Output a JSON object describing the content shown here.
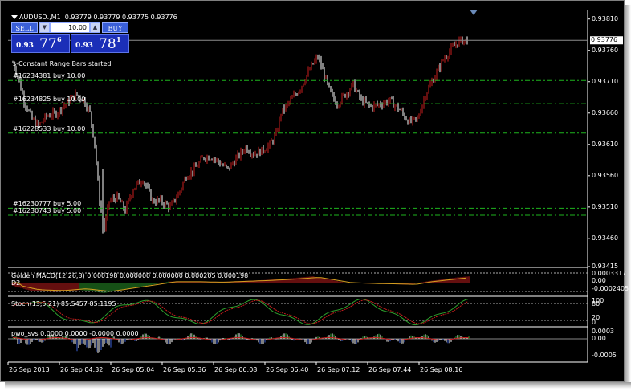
{
  "chart": {
    "symbol_icon": "triangle-down-icon",
    "title": "AUDUSD.,M1",
    "ohlc": "0.93779 0.93779 0.93775 0.93776",
    "status_message": "s-Constant Range Bars started"
  },
  "one_click": {
    "sell_label": "SELL",
    "buy_label": "BUY",
    "lot_value": "10.00",
    "bid_small": "0.93",
    "bid_big": "77",
    "bid_sup": "6",
    "ask_small": "0.93",
    "ask_big": "78",
    "ask_sup": "1"
  },
  "orders": [
    {
      "label": "#16234381 buy 10.00",
      "price": 0.93712
    },
    {
      "label": "#16234825 buy 10.00",
      "price": 0.93675
    },
    {
      "label": "#16228533 buy 10.00",
      "price": 0.93628
    },
    {
      "label": "#16230777 buy 5.00",
      "price": 0.93508
    },
    {
      "label": "#16230743 buy 5.00",
      "price": 0.93497
    }
  ],
  "price_axis": {
    "ticks": [
      "0.93810",
      "0.93760",
      "0.93710",
      "0.93660",
      "0.93610",
      "0.93560",
      "0.93510",
      "0.93460",
      "0.93415"
    ],
    "current": "0.93776"
  },
  "macd": {
    "label": "Golden MACD(12,26,3) 0.000198 0.000000 0.000000 0.000205 0.000198",
    "sublabel": "D2",
    "ticks": [
      "0.0003317",
      "0.00",
      "-0.0002405"
    ]
  },
  "stoch": {
    "label": "Stoch(13,5,21) 85.5457 85.1195",
    "ticks": [
      "100",
      "80",
      "20",
      "0"
    ]
  },
  "pwo": {
    "label": "pwo_svs 0.0000 0.0000 -0.0000 0.0000",
    "ticks": [
      "0.0003",
      "0.00",
      "-0.0005"
    ]
  },
  "time_axis": {
    "labels": [
      "26 Sep 2013",
      "26 Sep 04:32",
      "26 Sep 05:04",
      "26 Sep 05:36",
      "26 Sep 06:08",
      "26 Sep 06:40",
      "26 Sep 07:12",
      "26 Sep 07:44",
      "26 Sep 08:16"
    ]
  },
  "colors": {
    "background": "#000000",
    "bull": "#ffffff",
    "bear": "#c81e1e",
    "order_line": "#1eb41e",
    "grid_text": "#ffffff",
    "macd_green": "#2da02d",
    "macd_red": "#c81e1e",
    "signal": "#d4a020"
  },
  "chart_data": {
    "type": "line",
    "title": "AUDUSD.,M1",
    "xlabel": "",
    "ylabel": "",
    "x": [
      "26 Sep 2013",
      "26 Sep 04:32",
      "26 Sep 05:04",
      "26 Sep 05:36",
      "26 Sep 06:08",
      "26 Sep 06:40",
      "26 Sep 07:12",
      "26 Sep 07:44",
      "26 Sep 08:16"
    ],
    "ylim": [
      0.93415,
      0.93825
    ],
    "series": [
      {
        "name": "AUDUSD.,M1",
        "values": [
          0.93735,
          0.9351,
          0.9352,
          0.93575,
          0.9361,
          0.9374,
          0.93675,
          0.9365,
          0.93776
        ]
      }
    ]
  }
}
